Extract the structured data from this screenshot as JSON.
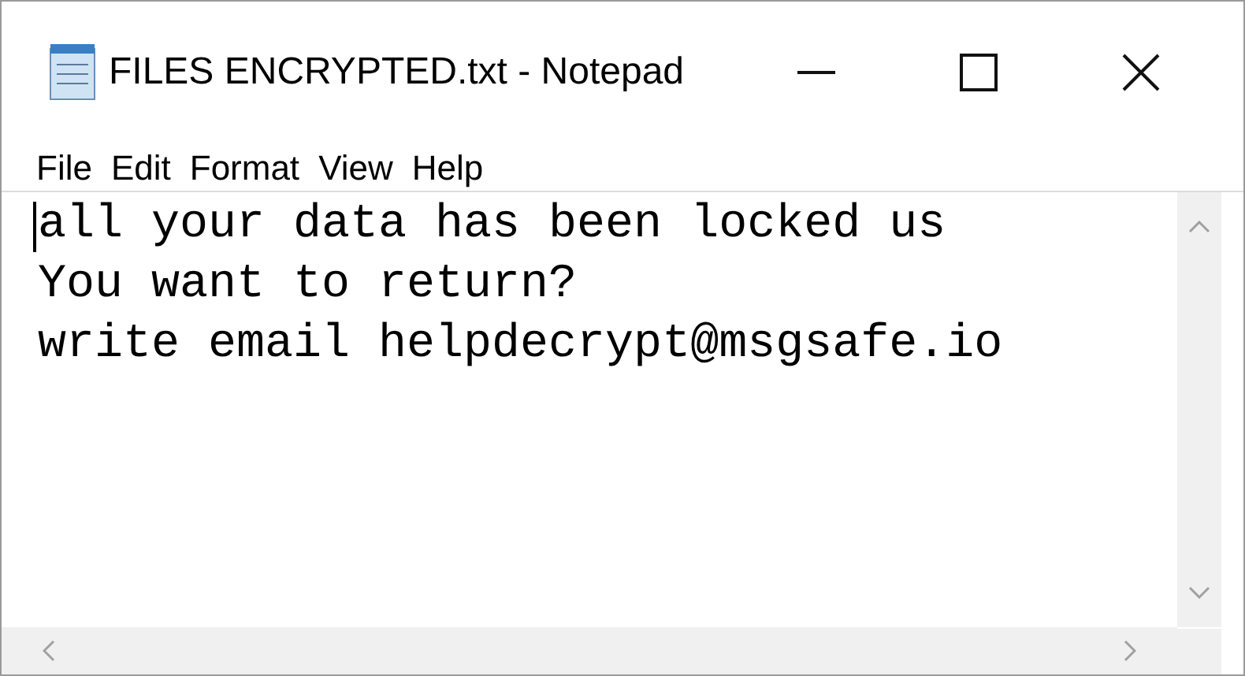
{
  "window": {
    "title": "FILES ENCRYPTED.txt - Notepad"
  },
  "menu": [
    "File",
    "Edit",
    "Format",
    "View",
    "Help"
  ],
  "editor": {
    "lines": [
      "all your data has been locked us",
      "You want to return?",
      "write email helpdecrypt@msgsafe.io"
    ]
  }
}
